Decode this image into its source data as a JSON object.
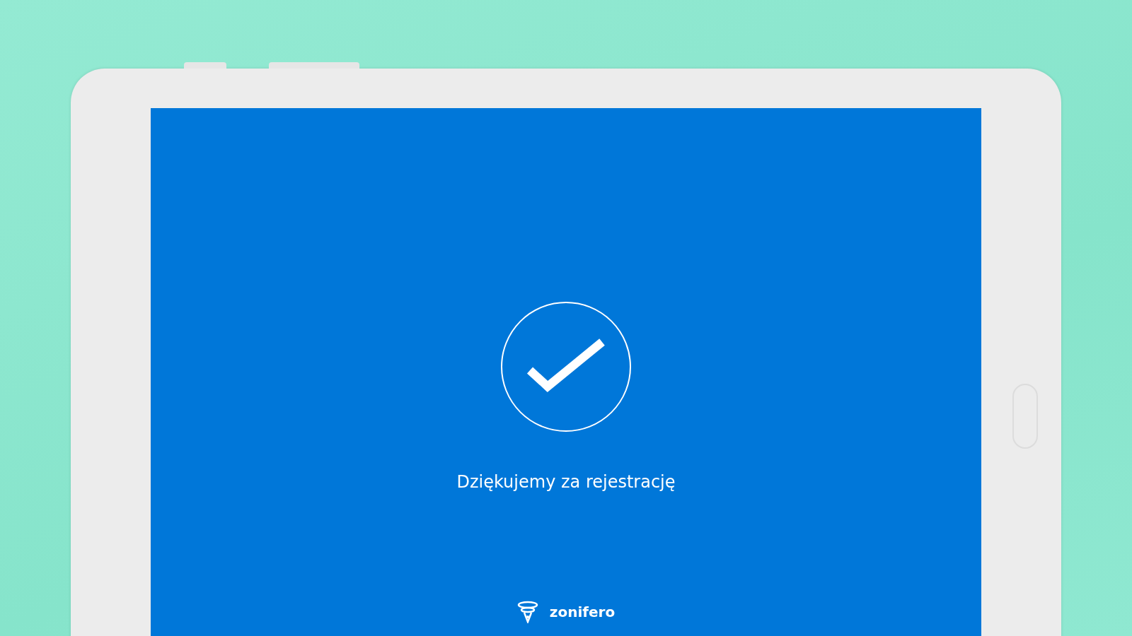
{
  "screen": {
    "message": "Dziękujemy za rejestrację",
    "brand": "zonifero"
  }
}
